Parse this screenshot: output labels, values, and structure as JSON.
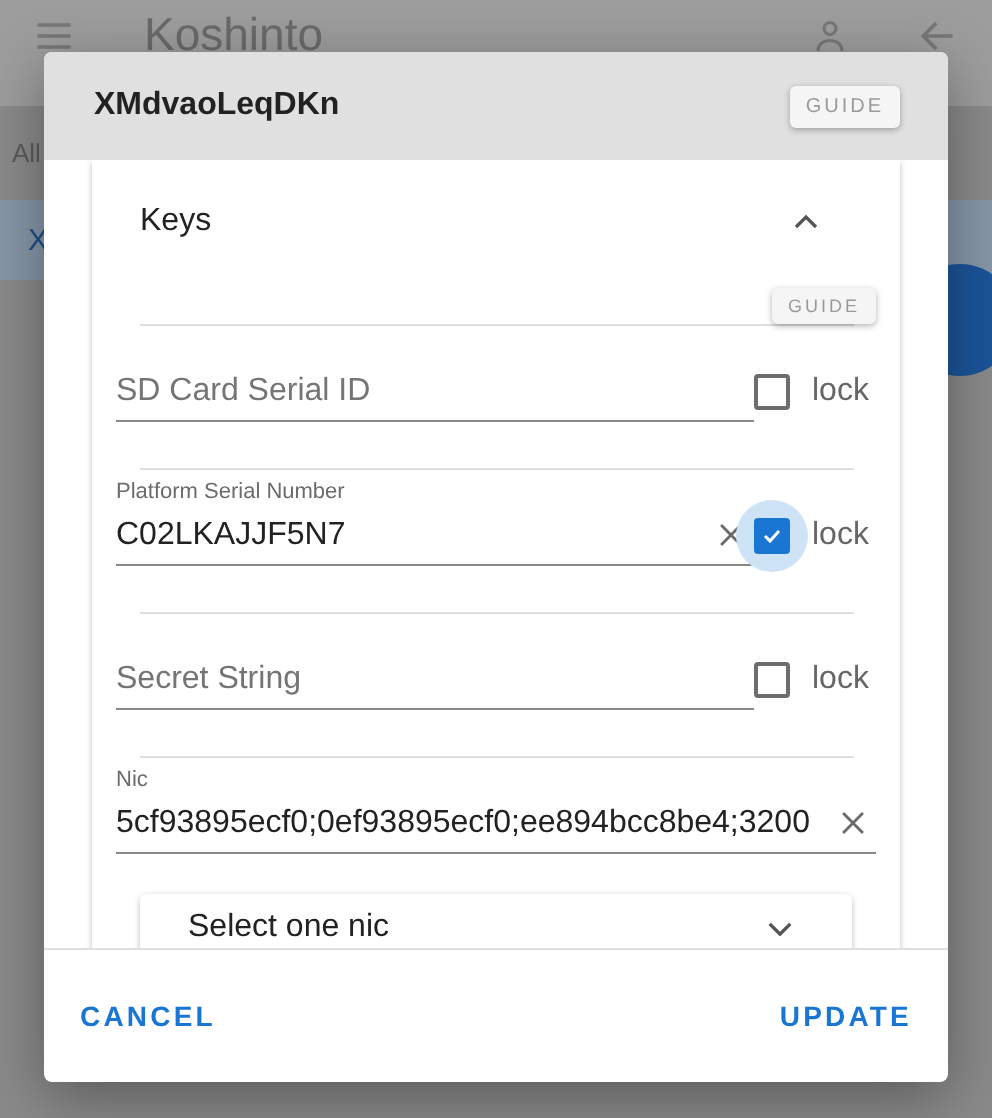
{
  "app_bar": {
    "title": "Koshinto"
  },
  "filter": {
    "label": "All"
  },
  "list_row": {
    "text": "X"
  },
  "dialog": {
    "title": "XMdvaoLeqDKn",
    "guide_button": "GUIDE",
    "section": {
      "title": "Keys",
      "expanded": true,
      "guide_button": "GUIDE",
      "fields": [
        {
          "kind": "lock",
          "label": "SD Card Serial ID",
          "checked": false,
          "focused": false,
          "lock_label": "lock"
        },
        {
          "kind": "lock",
          "label": "Platform Serial Number",
          "value": "C02LKAJJF5N7",
          "checked": true,
          "focused": true,
          "lock_label": "lock"
        },
        {
          "kind": "lock",
          "label": "Secret String",
          "checked": false,
          "focused": false,
          "lock_label": "lock"
        },
        {
          "kind": "plain",
          "label": "Nic",
          "value": "5cf93895ecf0;0ef93895ecf0;ee894bcc8be4;3200"
        }
      ],
      "select": {
        "placeholder": "Select one nic"
      }
    },
    "buttons": [
      "CANCEL",
      "UPDATE"
    ]
  }
}
